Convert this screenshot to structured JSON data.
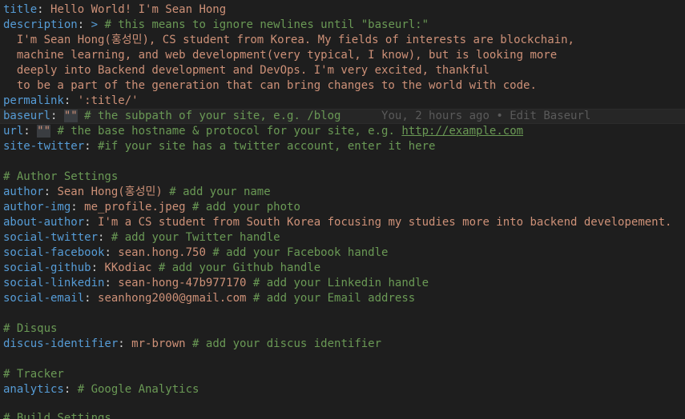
{
  "lines": {
    "title_key": "title",
    "title_val": "Hello World! I'm Sean Hong",
    "desc_key": "description",
    "desc_fold": ">",
    "desc_comment": "# this means to ignore newlines until \"baseurl:\"",
    "desc_1": "  I'm Sean Hong(홍성민), CS student from Korea. My fields of interests are blockchain,",
    "desc_2": "  machine learning, and web development(very typical, I know), but is looking more",
    "desc_3": "  deeply into Backend development and DevOps. I'm very excited, thankful",
    "desc_4": "  to be a part of the generation that can bring changes to the world with code.",
    "permalink_key": "permalink",
    "permalink_val": "':title/'",
    "baseurl_key": "baseurl",
    "baseurl_val": "\"\"",
    "baseurl_comment": "# the subpath of your site, e.g. /blog",
    "baseurl_blame": "You, 2 hours ago • Edit Baseurl",
    "url_key": "url",
    "url_val": "\"\"",
    "url_comment": "# the base hostname & protocol for your site, e.g.",
    "url_link": "http://example.com",
    "twitter_key": "site-twitter",
    "twitter_comment": "#if your site has a twitter account, enter it here",
    "author_section": "# Author Settings",
    "author_key": "author",
    "author_val": "Sean Hong(홍성민)",
    "author_comment": "# add your name",
    "author_img_key": "author-img",
    "author_img_val": "me_profile.jpeg",
    "author_img_comment": "# add your photo",
    "about_key": "about-author",
    "about_val": "I'm a CS student from South Korea focusing my studies more into backend developement.",
    "stw_key": "social-twitter",
    "stw_comment": "# add your Twitter handle",
    "sfb_key": "social-facebook",
    "sfb_val": "sean.hong.750",
    "sfb_comment": "# add your Facebook handle",
    "sgh_key": "social-github",
    "sgh_val": "KKodiac",
    "sgh_comment": "# add your Github handle",
    "sli_key": "social-linkedin",
    "sli_val": "sean-hong-47b977170",
    "sli_comment": "# add your Linkedin handle",
    "sem_key": "social-email",
    "sem_val": "seanhong2000@gmail.com",
    "sem_comment": "# add your Email address",
    "disqus_section": "# Disqus",
    "discus_key": "discus-identifier",
    "discus_val": "mr-brown",
    "discus_comment": "# add your discus identifier",
    "tracker_section": "# Tracker",
    "analytics_key": "analytics",
    "analytics_comment": "# Google Analytics",
    "build_section": "# Build Settings"
  }
}
